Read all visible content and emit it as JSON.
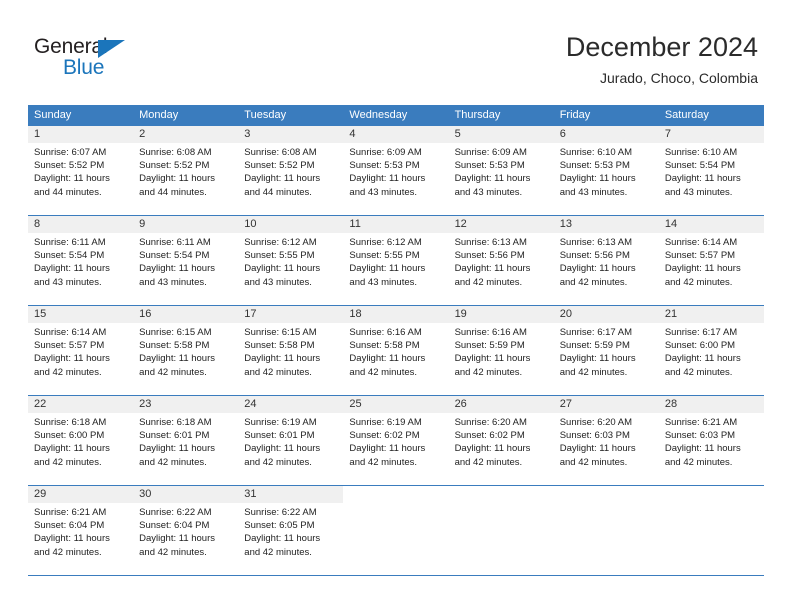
{
  "brand": {
    "name_top": "General",
    "name_bottom": "Blue",
    "triangle_color": "#1b75bb",
    "text_color": "#231f20"
  },
  "header": {
    "title": "December 2024",
    "location": "Jurado, Choco, Colombia"
  },
  "colors": {
    "header_blue": "#3a7cbe",
    "day_band_gray": "#f0f0f0",
    "text": "#222222"
  },
  "weekdays": [
    "Sunday",
    "Monday",
    "Tuesday",
    "Wednesday",
    "Thursday",
    "Friday",
    "Saturday"
  ],
  "weeks": [
    [
      {
        "day": "1",
        "sunrise": "Sunrise: 6:07 AM",
        "sunset": "Sunset: 5:52 PM",
        "daylight1": "Daylight: 11 hours",
        "daylight2": "and 44 minutes."
      },
      {
        "day": "2",
        "sunrise": "Sunrise: 6:08 AM",
        "sunset": "Sunset: 5:52 PM",
        "daylight1": "Daylight: 11 hours",
        "daylight2": "and 44 minutes."
      },
      {
        "day": "3",
        "sunrise": "Sunrise: 6:08 AM",
        "sunset": "Sunset: 5:52 PM",
        "daylight1": "Daylight: 11 hours",
        "daylight2": "and 44 minutes."
      },
      {
        "day": "4",
        "sunrise": "Sunrise: 6:09 AM",
        "sunset": "Sunset: 5:53 PM",
        "daylight1": "Daylight: 11 hours",
        "daylight2": "and 43 minutes."
      },
      {
        "day": "5",
        "sunrise": "Sunrise: 6:09 AM",
        "sunset": "Sunset: 5:53 PM",
        "daylight1": "Daylight: 11 hours",
        "daylight2": "and 43 minutes."
      },
      {
        "day": "6",
        "sunrise": "Sunrise: 6:10 AM",
        "sunset": "Sunset: 5:53 PM",
        "daylight1": "Daylight: 11 hours",
        "daylight2": "and 43 minutes."
      },
      {
        "day": "7",
        "sunrise": "Sunrise: 6:10 AM",
        "sunset": "Sunset: 5:54 PM",
        "daylight1": "Daylight: 11 hours",
        "daylight2": "and 43 minutes."
      }
    ],
    [
      {
        "day": "8",
        "sunrise": "Sunrise: 6:11 AM",
        "sunset": "Sunset: 5:54 PM",
        "daylight1": "Daylight: 11 hours",
        "daylight2": "and 43 minutes."
      },
      {
        "day": "9",
        "sunrise": "Sunrise: 6:11 AM",
        "sunset": "Sunset: 5:54 PM",
        "daylight1": "Daylight: 11 hours",
        "daylight2": "and 43 minutes."
      },
      {
        "day": "10",
        "sunrise": "Sunrise: 6:12 AM",
        "sunset": "Sunset: 5:55 PM",
        "daylight1": "Daylight: 11 hours",
        "daylight2": "and 43 minutes."
      },
      {
        "day": "11",
        "sunrise": "Sunrise: 6:12 AM",
        "sunset": "Sunset: 5:55 PM",
        "daylight1": "Daylight: 11 hours",
        "daylight2": "and 43 minutes."
      },
      {
        "day": "12",
        "sunrise": "Sunrise: 6:13 AM",
        "sunset": "Sunset: 5:56 PM",
        "daylight1": "Daylight: 11 hours",
        "daylight2": "and 42 minutes."
      },
      {
        "day": "13",
        "sunrise": "Sunrise: 6:13 AM",
        "sunset": "Sunset: 5:56 PM",
        "daylight1": "Daylight: 11 hours",
        "daylight2": "and 42 minutes."
      },
      {
        "day": "14",
        "sunrise": "Sunrise: 6:14 AM",
        "sunset": "Sunset: 5:57 PM",
        "daylight1": "Daylight: 11 hours",
        "daylight2": "and 42 minutes."
      }
    ],
    [
      {
        "day": "15",
        "sunrise": "Sunrise: 6:14 AM",
        "sunset": "Sunset: 5:57 PM",
        "daylight1": "Daylight: 11 hours",
        "daylight2": "and 42 minutes."
      },
      {
        "day": "16",
        "sunrise": "Sunrise: 6:15 AM",
        "sunset": "Sunset: 5:58 PM",
        "daylight1": "Daylight: 11 hours",
        "daylight2": "and 42 minutes."
      },
      {
        "day": "17",
        "sunrise": "Sunrise: 6:15 AM",
        "sunset": "Sunset: 5:58 PM",
        "daylight1": "Daylight: 11 hours",
        "daylight2": "and 42 minutes."
      },
      {
        "day": "18",
        "sunrise": "Sunrise: 6:16 AM",
        "sunset": "Sunset: 5:58 PM",
        "daylight1": "Daylight: 11 hours",
        "daylight2": "and 42 minutes."
      },
      {
        "day": "19",
        "sunrise": "Sunrise: 6:16 AM",
        "sunset": "Sunset: 5:59 PM",
        "daylight1": "Daylight: 11 hours",
        "daylight2": "and 42 minutes."
      },
      {
        "day": "20",
        "sunrise": "Sunrise: 6:17 AM",
        "sunset": "Sunset: 5:59 PM",
        "daylight1": "Daylight: 11 hours",
        "daylight2": "and 42 minutes."
      },
      {
        "day": "21",
        "sunrise": "Sunrise: 6:17 AM",
        "sunset": "Sunset: 6:00 PM",
        "daylight1": "Daylight: 11 hours",
        "daylight2": "and 42 minutes."
      }
    ],
    [
      {
        "day": "22",
        "sunrise": "Sunrise: 6:18 AM",
        "sunset": "Sunset: 6:00 PM",
        "daylight1": "Daylight: 11 hours",
        "daylight2": "and 42 minutes."
      },
      {
        "day": "23",
        "sunrise": "Sunrise: 6:18 AM",
        "sunset": "Sunset: 6:01 PM",
        "daylight1": "Daylight: 11 hours",
        "daylight2": "and 42 minutes."
      },
      {
        "day": "24",
        "sunrise": "Sunrise: 6:19 AM",
        "sunset": "Sunset: 6:01 PM",
        "daylight1": "Daylight: 11 hours",
        "daylight2": "and 42 minutes."
      },
      {
        "day": "25",
        "sunrise": "Sunrise: 6:19 AM",
        "sunset": "Sunset: 6:02 PM",
        "daylight1": "Daylight: 11 hours",
        "daylight2": "and 42 minutes."
      },
      {
        "day": "26",
        "sunrise": "Sunrise: 6:20 AM",
        "sunset": "Sunset: 6:02 PM",
        "daylight1": "Daylight: 11 hours",
        "daylight2": "and 42 minutes."
      },
      {
        "day": "27",
        "sunrise": "Sunrise: 6:20 AM",
        "sunset": "Sunset: 6:03 PM",
        "daylight1": "Daylight: 11 hours",
        "daylight2": "and 42 minutes."
      },
      {
        "day": "28",
        "sunrise": "Sunrise: 6:21 AM",
        "sunset": "Sunset: 6:03 PM",
        "daylight1": "Daylight: 11 hours",
        "daylight2": "and 42 minutes."
      }
    ],
    [
      {
        "day": "29",
        "sunrise": "Sunrise: 6:21 AM",
        "sunset": "Sunset: 6:04 PM",
        "daylight1": "Daylight: 11 hours",
        "daylight2": "and 42 minutes."
      },
      {
        "day": "30",
        "sunrise": "Sunrise: 6:22 AM",
        "sunset": "Sunset: 6:04 PM",
        "daylight1": "Daylight: 11 hours",
        "daylight2": "and 42 minutes."
      },
      {
        "day": "31",
        "sunrise": "Sunrise: 6:22 AM",
        "sunset": "Sunset: 6:05 PM",
        "daylight1": "Daylight: 11 hours",
        "daylight2": "and 42 minutes."
      },
      {
        "day": "",
        "sunrise": "",
        "sunset": "",
        "daylight1": "",
        "daylight2": ""
      },
      {
        "day": "",
        "sunrise": "",
        "sunset": "",
        "daylight1": "",
        "daylight2": ""
      },
      {
        "day": "",
        "sunrise": "",
        "sunset": "",
        "daylight1": "",
        "daylight2": ""
      },
      {
        "day": "",
        "sunrise": "",
        "sunset": "",
        "daylight1": "",
        "daylight2": ""
      }
    ]
  ]
}
